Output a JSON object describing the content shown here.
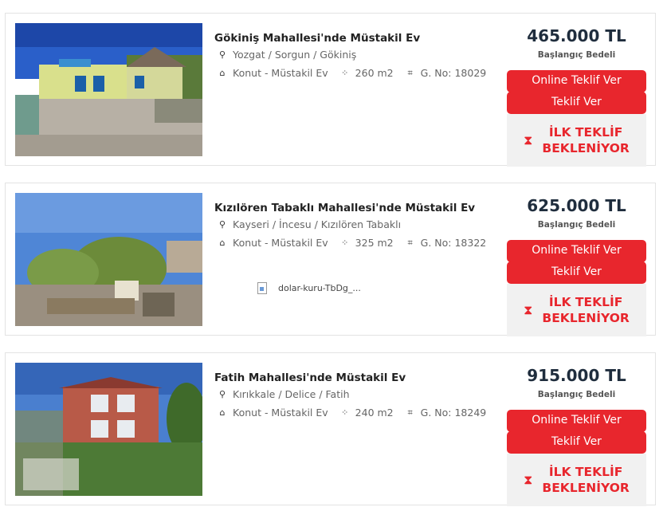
{
  "listings": [
    {
      "title": "Gökiniş Mahallesi'nde Müstakil Ev",
      "location": "Yozgat / Sorgun / Gökiniş",
      "type": "Konut - Müstakil Ev",
      "area": "260 m2",
      "gno": "G. No: 18029",
      "price": "465.000 TL",
      "price_label": "Başlangıç Bedeli",
      "btn_online": "Online Teklif Ver",
      "btn_offer": "Teklif Ver",
      "waiting_line1": "İLK TEKLİF",
      "waiting_line2": "BEKLENİYOR"
    },
    {
      "title": "Kızılören Tabaklı Mahallesi'nde Müstakil Ev",
      "location": "Kayseri / İncesu / Kızılören Tabaklı",
      "type": "Konut - Müstakil Ev",
      "area": "325 m2",
      "gno": "G. No: 18322",
      "price": "625.000 TL",
      "price_label": "Başlangıç Bedeli",
      "btn_online": "Online Teklif Ver",
      "btn_offer": "Teklif Ver",
      "waiting_line1": "İLK TEKLİF",
      "waiting_line2": "BEKLENİYOR",
      "broken_image_alt": "dolar-kuru-TbDg_..."
    },
    {
      "title": "Fatih Mahallesi'nde Müstakil Ev",
      "location": "Kırıkkale / Delice / Fatih",
      "type": "Konut - Müstakil Ev",
      "area": "240 m2",
      "gno": "G. No: 18249",
      "price": "915.000 TL",
      "price_label": "Başlangıç Bedeli",
      "btn_online": "Online Teklif Ver",
      "btn_offer": "Teklif Ver",
      "waiting_line1": "İLK TEKLİF",
      "waiting_line2": "BEKLENİYOR"
    }
  ],
  "icons": {
    "location": "location-pin-icon",
    "type": "house-icon",
    "area": "area-expand-icon",
    "gno": "parcel-icon",
    "waiting": "hourglass-icon"
  },
  "colors": {
    "accent_red": "#e8262d",
    "price_text": "#1f2d3d",
    "waiting_bg": "#f1f1f1"
  }
}
